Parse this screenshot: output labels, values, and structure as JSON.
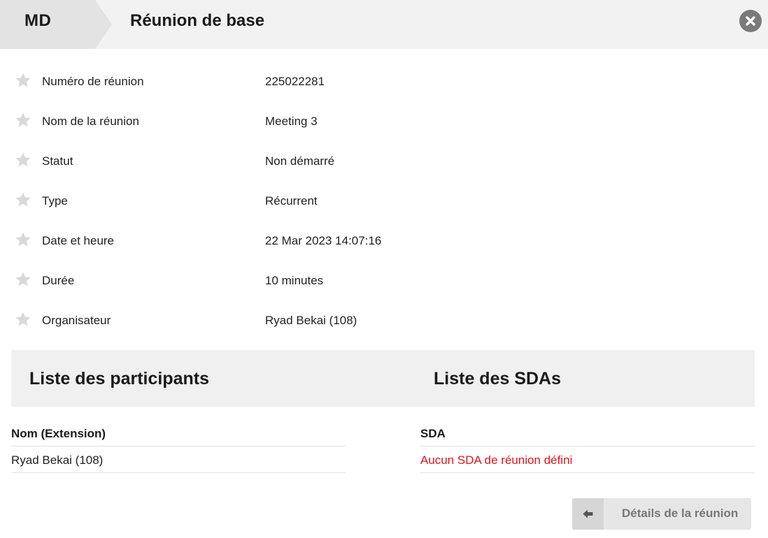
{
  "header": {
    "avatar_initials": "MD",
    "title": "Réunion de base",
    "close_icon": "close-circle-icon"
  },
  "info": {
    "rows": [
      {
        "label": "Numéro de réunion",
        "value": "225022281"
      },
      {
        "label": "Nom de la réunion",
        "value": "Meeting 3"
      },
      {
        "label": "Statut",
        "value": "Non démarré"
      },
      {
        "label": "Type",
        "value": "Récurrent"
      },
      {
        "label": "Date et heure",
        "value": "22 Mar 2023 14:07:16"
      },
      {
        "label": "Durée",
        "value": "10 minutes"
      },
      {
        "label": "Organisateur",
        "value": "Ryad Bekai (108)"
      }
    ]
  },
  "sections": {
    "participants_title": "Liste des participants",
    "sdas_title": "Liste des SDAs"
  },
  "participants": {
    "header": "Nom (Extension)",
    "rows": [
      "Ryad Bekai (108)"
    ]
  },
  "sdas": {
    "header": "SDA",
    "empty_message": "Aucun SDA de réunion défini"
  },
  "footer": {
    "details_button_label": "Détails de la réunion",
    "details_button_icon": "arrow-left-icon"
  },
  "colors": {
    "error": "#e3141b",
    "star": "#d9d9d9"
  }
}
